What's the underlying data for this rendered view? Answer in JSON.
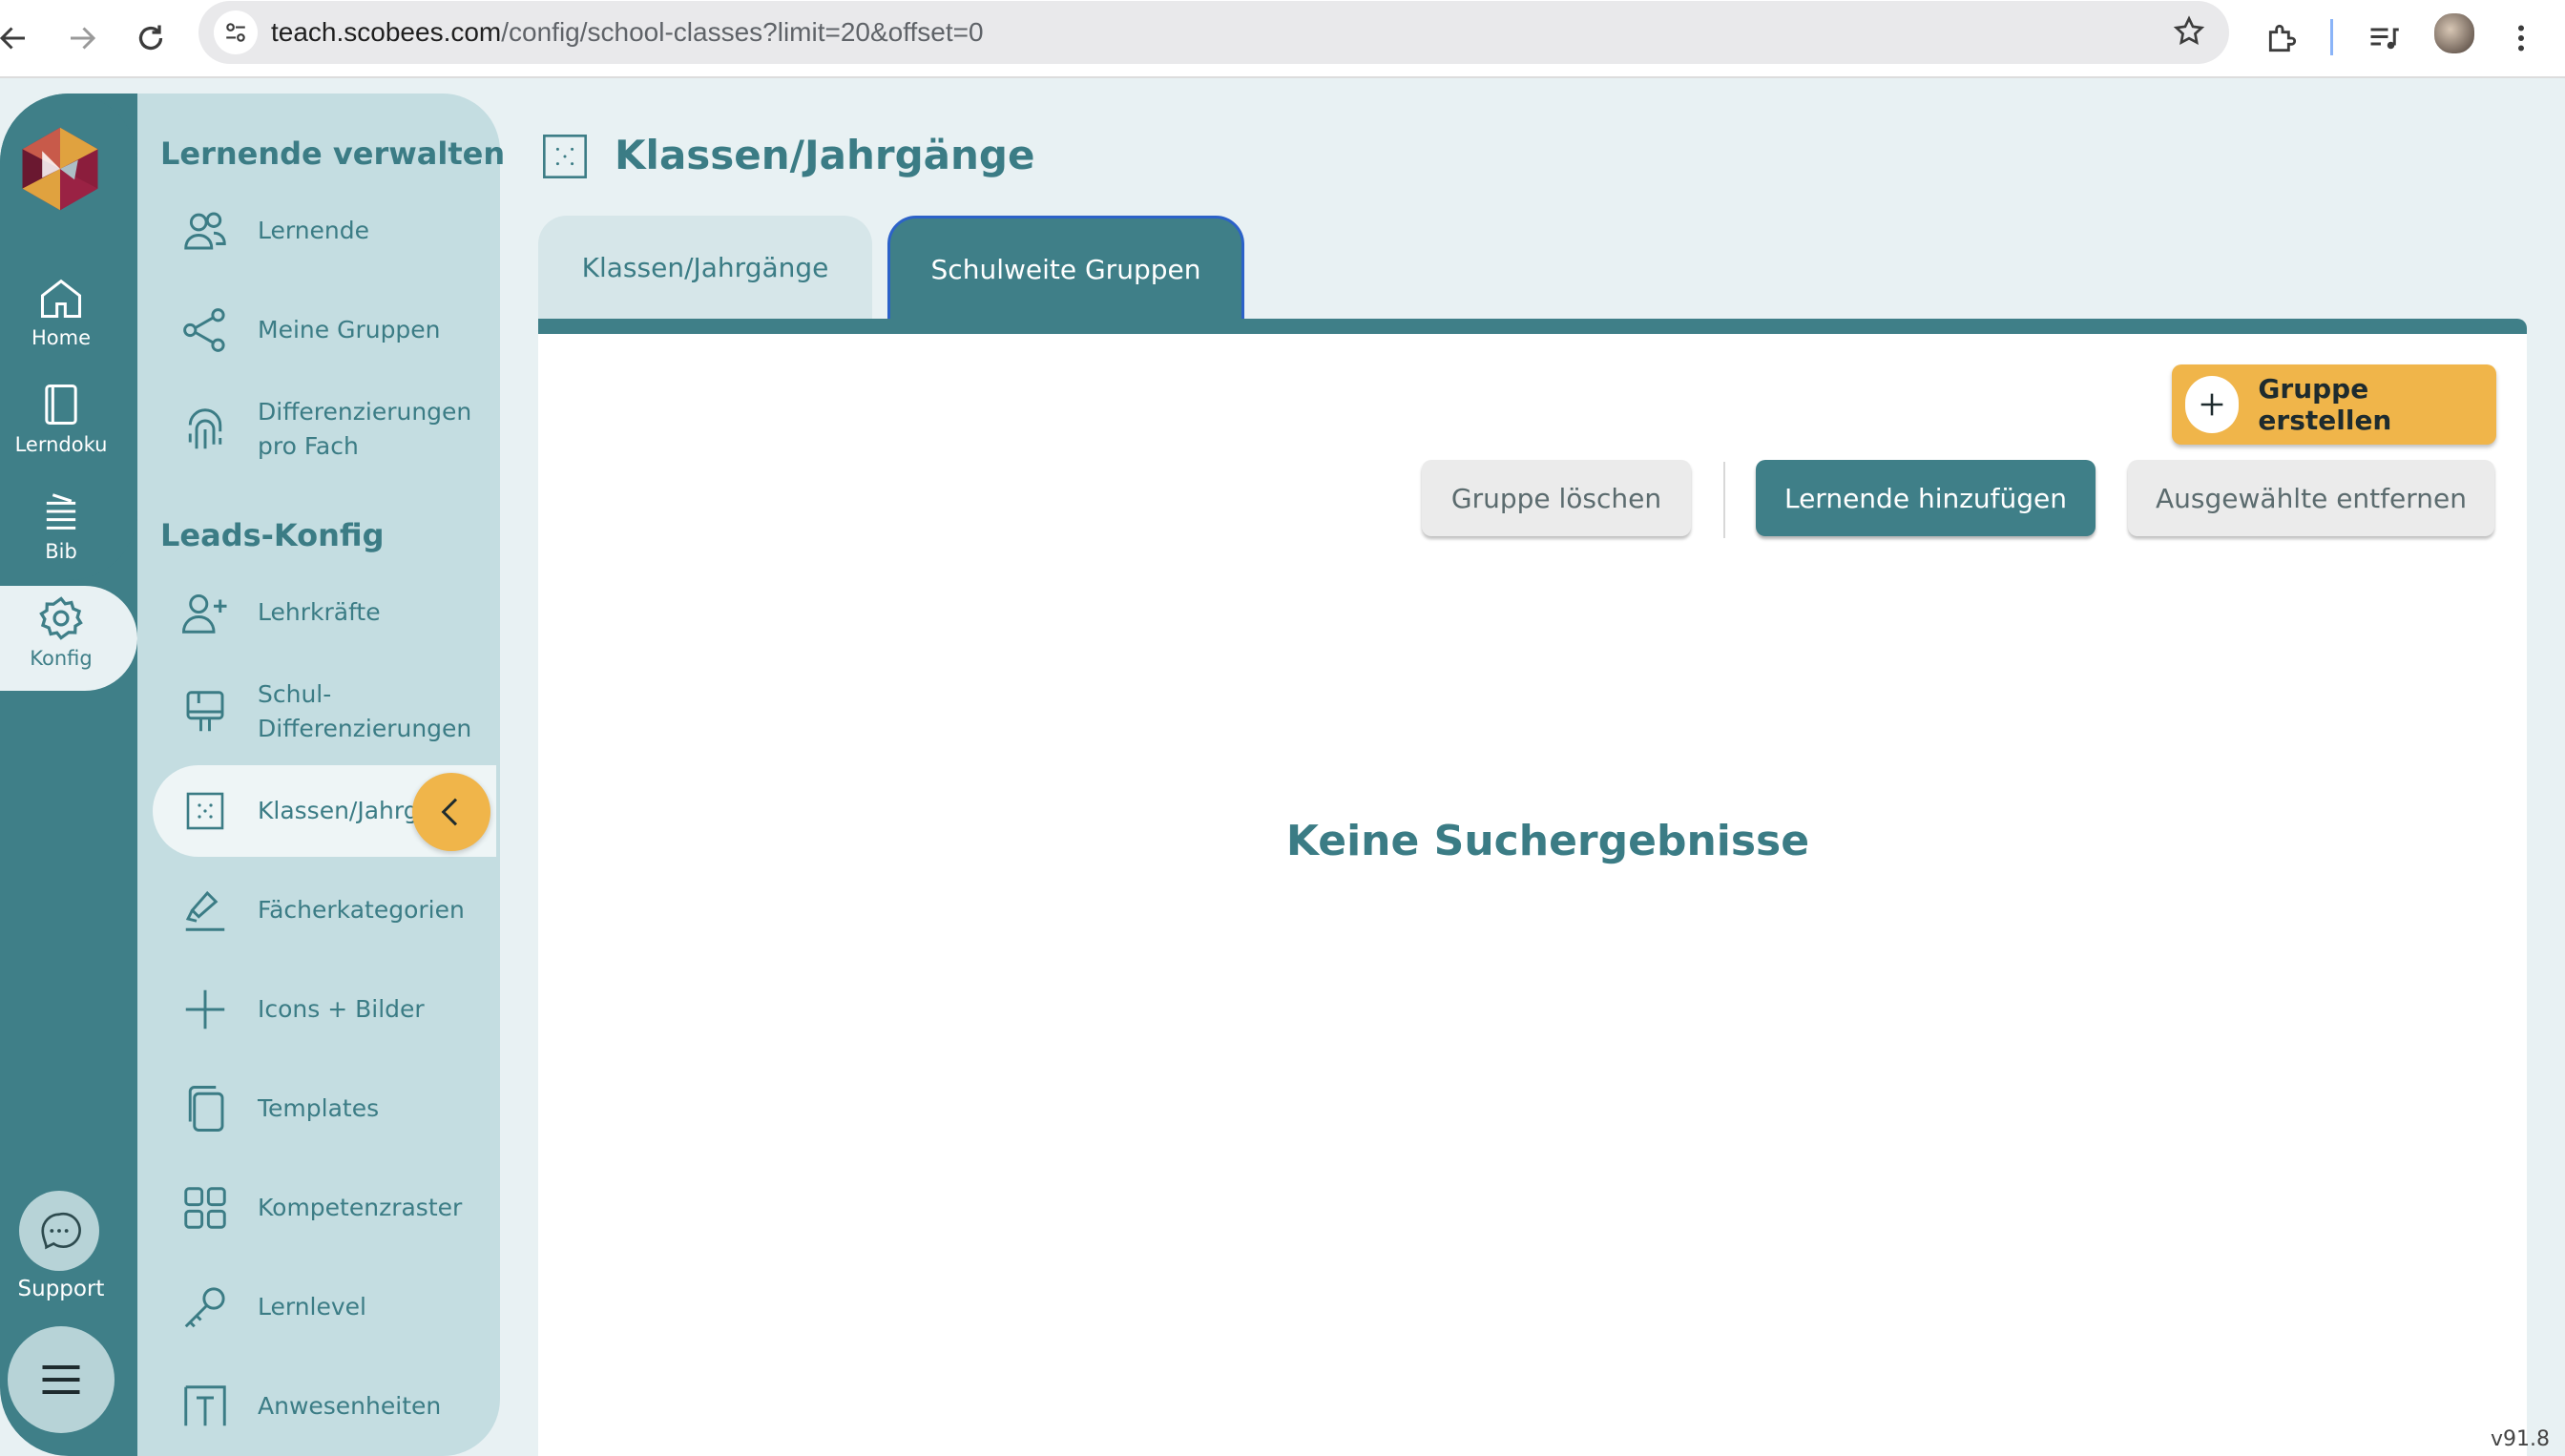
{
  "browser": {
    "url_host": "teach.scobees.com",
    "url_path": "/config/school-classes?limit=20&offset=0"
  },
  "rail": {
    "items": [
      {
        "label": "Home",
        "icon": "home-icon"
      },
      {
        "label": "Lerndoku",
        "icon": "book-icon"
      },
      {
        "label": "Bib",
        "icon": "library-icon"
      },
      {
        "label": "Konfig",
        "icon": "gear-icon",
        "active": true
      }
    ],
    "support_label": "Support"
  },
  "sidebar": {
    "section1_title": "Lernende verwalten",
    "section2_title": "Leads-Konfig",
    "items": [
      {
        "label": "Lernende",
        "icon": "users-icon"
      },
      {
        "label": "Meine Gruppen",
        "icon": "share-icon"
      },
      {
        "label_line1": "Differenzierungen",
        "label_line2": "pro Fach",
        "icon": "fingerprint-icon"
      },
      {
        "label": "Lehrkräfte",
        "icon": "user-plus-icon"
      },
      {
        "label_line1": "Schul-",
        "label_line2": "Differenzierungen",
        "icon": "board-icon"
      },
      {
        "label": "Klassen/Jahrgänge",
        "icon": "dotted-square-icon",
        "active": true
      },
      {
        "label": "Fächerkategorien",
        "icon": "pen-icon"
      },
      {
        "label": "Icons + Bilder",
        "icon": "plus-icon"
      },
      {
        "label": "Templates",
        "icon": "copy-icon"
      },
      {
        "label": "Kompetenzraster",
        "icon": "grid-icon"
      },
      {
        "label": "Lernlevel",
        "icon": "key-icon"
      },
      {
        "label": "Anwesenheiten",
        "icon": "door-icon"
      }
    ]
  },
  "main": {
    "title": "Klassen/Jahrgänge",
    "tabs": [
      {
        "label": "Klassen/Jahrgänge"
      },
      {
        "label": "Schulweite Gruppen",
        "active": true
      }
    ],
    "buttons": {
      "create": "Gruppe erstellen",
      "delete": "Gruppe löschen",
      "add_learners": "Lernende hinzufügen",
      "remove_selected": "Ausgewählte entfernen"
    },
    "empty_message": "Keine Suchergebnisse",
    "version": "v91.8"
  },
  "colors": {
    "teal": "#3f7f88",
    "sidebar_bg": "#c4dde1",
    "accent_yellow": "#f0b54a",
    "page_bg": "#e8f1f3"
  }
}
